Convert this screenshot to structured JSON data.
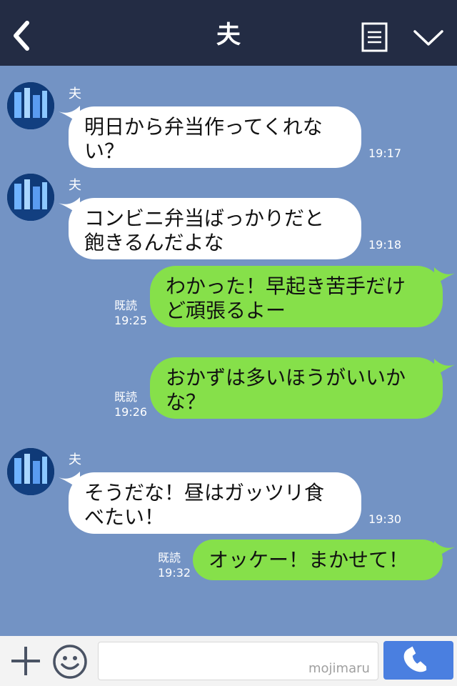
{
  "header": {
    "title": "夫"
  },
  "messages": [
    {
      "sender": "夫",
      "text_line1": "明日から弁当作ってくれな",
      "text_line2": "い？",
      "time": "19:17"
    },
    {
      "sender": "夫",
      "text_line1": "コンビニ弁当ばっかりだと",
      "text_line2": "飽きるんだよな",
      "time": "19:18"
    },
    {
      "read": "既読",
      "time": "19:25",
      "text_line1": "わかった！早起き苦手だけ",
      "text_line2": "ど頑張るよー"
    },
    {
      "read": "既読",
      "time": "19:26",
      "text_line1": "おかずは多いほうがいいか",
      "text_line2": "な？"
    },
    {
      "sender": "夫",
      "text_line1": "そうだな！昼はガッツリ食",
      "text_line2": "べたい！",
      "time": "19:30"
    },
    {
      "read": "既読",
      "time": "19:32",
      "text_line1": "オッケー！まかせて！"
    }
  ],
  "input": {
    "watermark": "mojimaru"
  },
  "colors": {
    "header_bg": "#232c44",
    "chat_bg": "#7393c4",
    "incoming_bubble": "#ffffff",
    "outgoing_bubble": "#86e04a",
    "call_button": "#4a7fe0"
  },
  "icons": [
    "back-chevron-icon",
    "notes-icon",
    "chevron-down-icon",
    "plus-icon",
    "emoji-icon",
    "phone-icon"
  ]
}
